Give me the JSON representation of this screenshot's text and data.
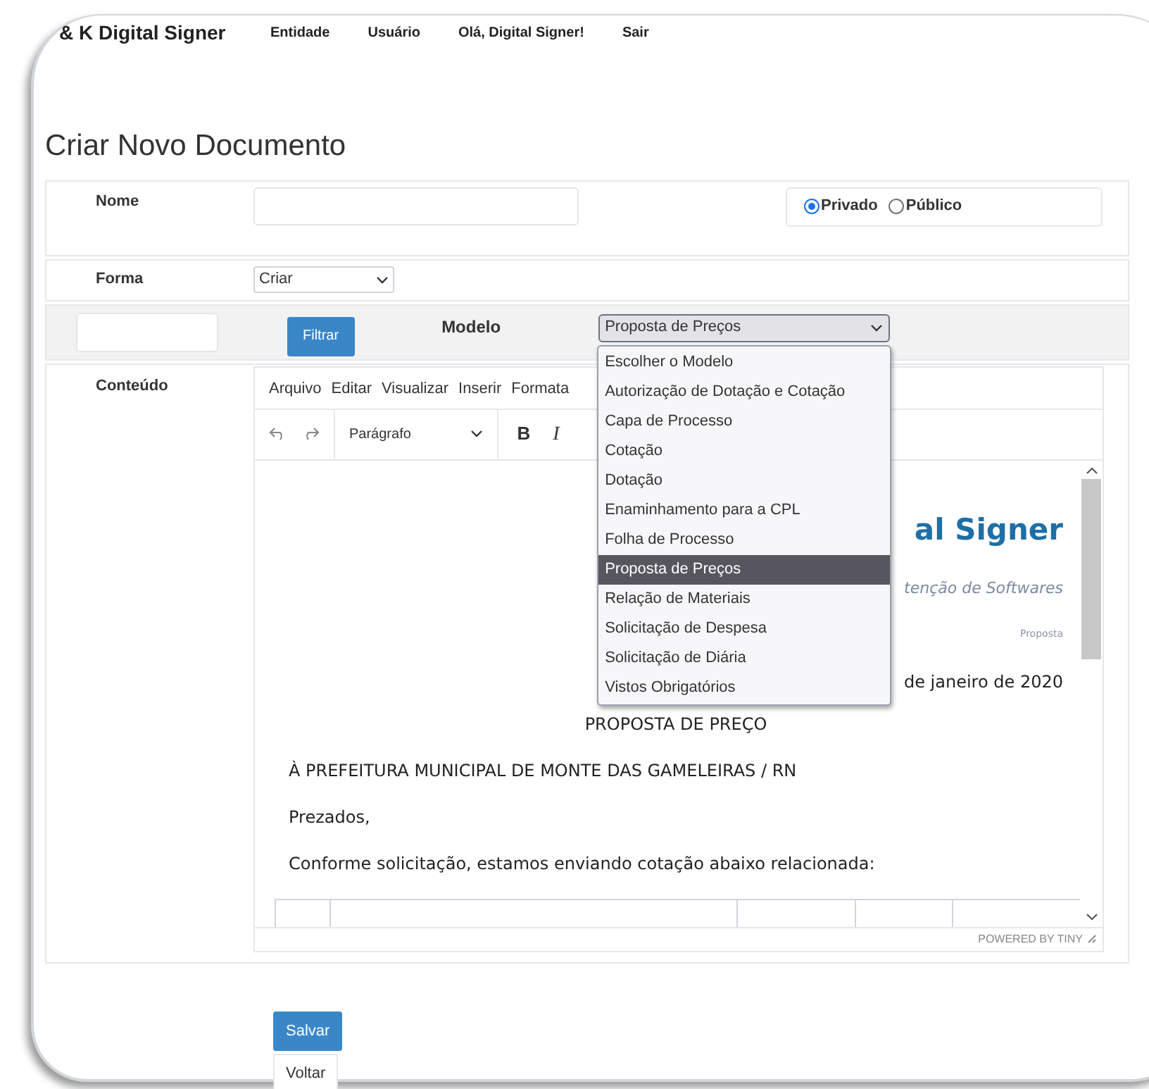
{
  "nav": {
    "brand": "& K Digital Signer",
    "links": [
      "Entidade",
      "Usuário",
      "Olá, Digital Signer!",
      "Sair"
    ]
  },
  "title": "Criar Novo Documento",
  "nome": {
    "label": "Nome"
  },
  "visibility": [
    {
      "label": "Privado",
      "selected": true
    },
    {
      "label": "Público",
      "selected": false
    }
  ],
  "forma": {
    "label": "Forma",
    "value": "Criar"
  },
  "filter_button": "Filtrar",
  "modelo": {
    "label": "Modelo",
    "value": "Proposta de Preços",
    "expanded": true,
    "options": [
      {
        "label": "Escolher o Modelo",
        "selected": false
      },
      {
        "label": "Autorização de Dotação e Cotação",
        "selected": false
      },
      {
        "label": "Capa de Processo",
        "selected": false
      },
      {
        "label": "Cotação",
        "selected": false
      },
      {
        "label": "Dotação",
        "selected": false
      },
      {
        "label": "Enaminhamento para a CPL",
        "selected": false
      },
      {
        "label": "Folha de Processo",
        "selected": false
      },
      {
        "label": "Proposta de Preços",
        "selected": true
      },
      {
        "label": "Relação de Materiais",
        "selected": false
      },
      {
        "label": "Solicitação de Despesa",
        "selected": false
      },
      {
        "label": "Solicitação de Diária",
        "selected": false
      },
      {
        "label": "Vistos Obrigatórios",
        "selected": false
      }
    ]
  },
  "conteudo_label": "Conteúdo",
  "editor": {
    "menu": [
      "Arquivo",
      "Editar",
      "Visualizar",
      "Inserir",
      "Formata"
    ],
    "toolbar": {
      "block_format": "Parágrafo",
      "bold": "B",
      "italic": "I"
    },
    "document": {
      "logo_text": "al Signer",
      "tagline": "tenção de Softwares",
      "doc_tag": "Proposta",
      "date": "de janeiro de 2020",
      "heading": "PROPOSTA DE PREÇO",
      "paragraphs": [
        "À PREFEITURA MUNICIPAL DE MONTE DAS GAMELEIRAS / RN",
        "Prezados,",
        "Conforme solicitação, estamos enviando cotação abaixo relacionada:"
      ]
    },
    "status": "POWERED BY TINY"
  },
  "buttons": [
    {
      "label": "Salvar",
      "kind": "primary"
    },
    {
      "label": "Voltar",
      "kind": "default"
    }
  ]
}
